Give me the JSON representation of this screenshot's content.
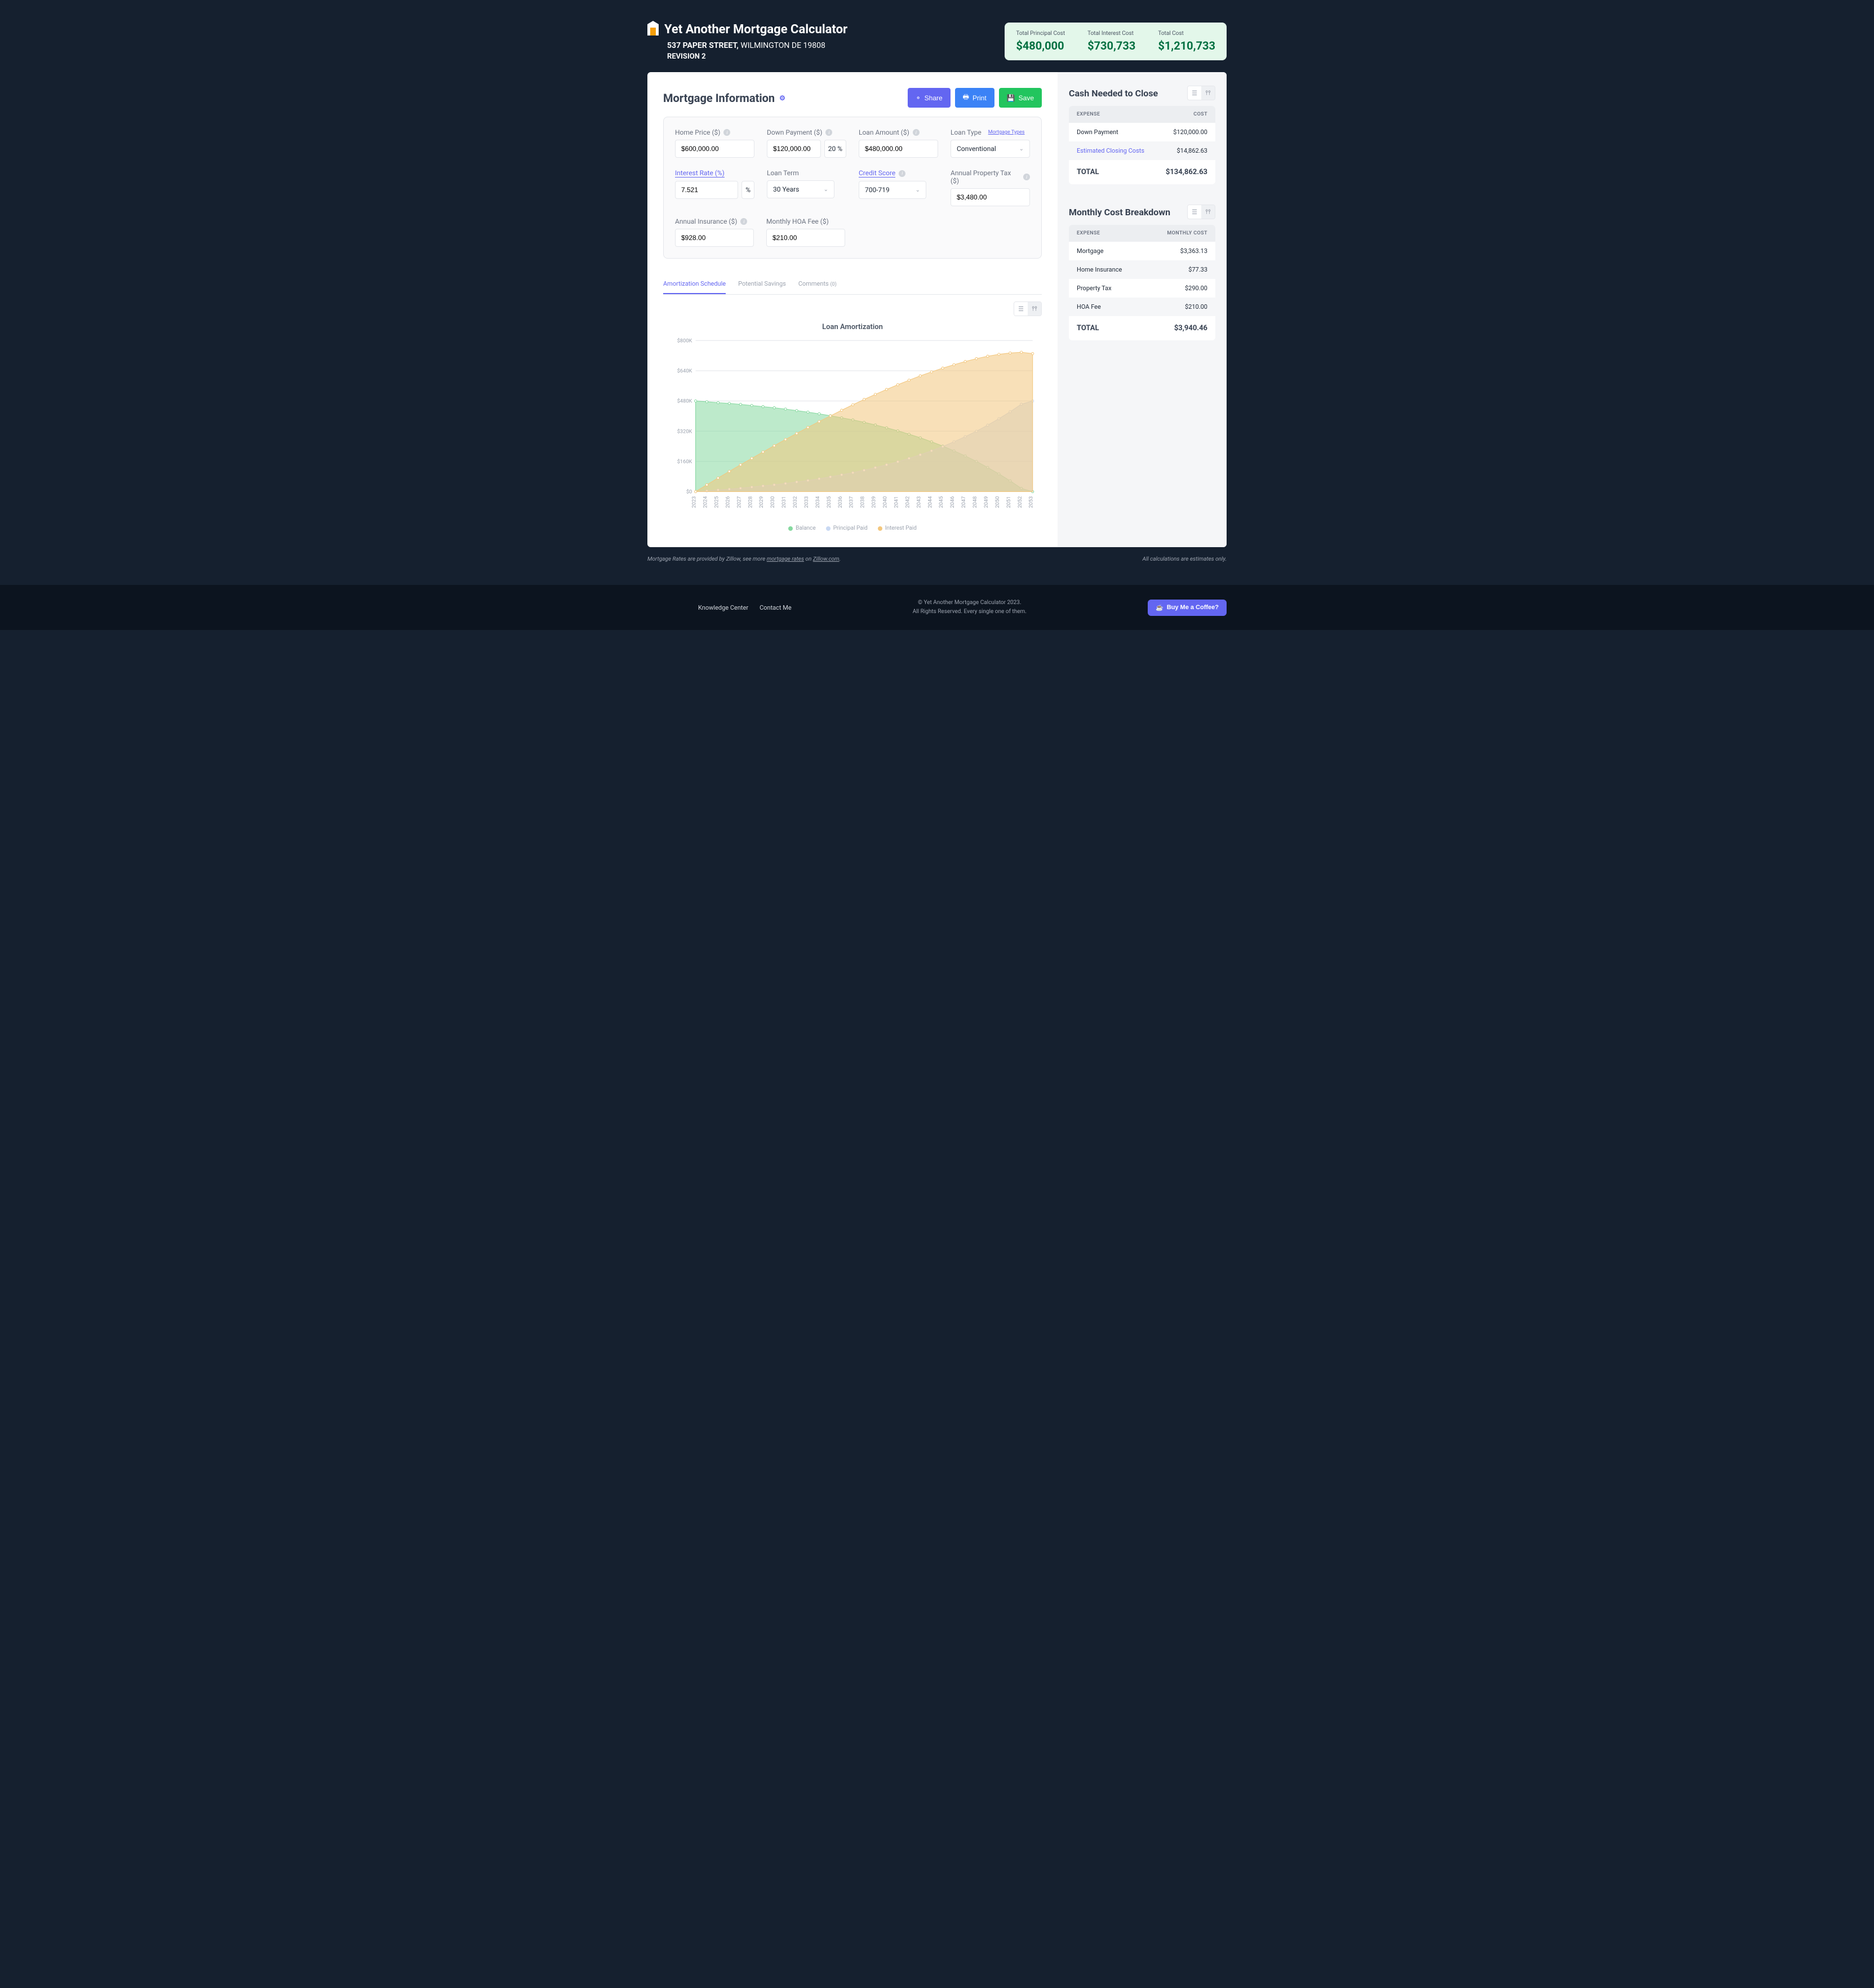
{
  "app_title": "Yet Another Mortgage Calculator",
  "address_street": "537 PAPER STREET,",
  "address_city": "WILMINGTON DE 19808",
  "revision": "REVISION 2",
  "summary": {
    "principal_label": "Total Principal Cost",
    "principal_value": "$480,000",
    "interest_label": "Total Interest Cost",
    "interest_value": "$730,733",
    "total_label": "Total Cost",
    "total_value": "$1,210,733"
  },
  "mortgage_info_title": "Mortgage Information",
  "buttons": {
    "share": "Share",
    "print": "Print",
    "save": "Save"
  },
  "form": {
    "home_price_label": "Home Price ($)",
    "home_price": "$600,000.00",
    "down_payment_label": "Down Payment ($)",
    "down_payment": "$120,000.00",
    "down_payment_pct": "20",
    "loan_amount_label": "Loan Amount ($)",
    "loan_amount": "$480,000.00",
    "loan_type_label": "Loan Type",
    "mortgage_types_link": "Mortgage Types",
    "loan_type": "Conventional",
    "interest_rate_label": "Interest Rate (%)",
    "interest_rate": "7.521",
    "loan_term_label": "Loan Term",
    "loan_term": "30 Years",
    "credit_score_label": "Credit Score",
    "credit_score": "700-719",
    "property_tax_label": "Annual Property Tax ($)",
    "property_tax": "$3,480.00",
    "insurance_label": "Annual Insurance ($)",
    "insurance": "$928.00",
    "hoa_label": "Monthly HOA Fee ($)",
    "hoa": "$210.00"
  },
  "tabs": {
    "amortization": "Amortization Schedule",
    "savings": "Potential Savings",
    "comments": "Comments",
    "comments_count": "(0)"
  },
  "chart_title": "Loan Amortization",
  "legend": {
    "balance": "Balance",
    "principal": "Principal Paid",
    "interest": "Interest Paid"
  },
  "cash_to_close": {
    "title": "Cash Needed to Close",
    "head_expense": "EXPENSE",
    "head_cost": "COST",
    "rows": [
      {
        "label": "Down Payment",
        "value": "$120,000.00"
      },
      {
        "label": "Estimated Closing Costs",
        "value": "$14,862.63",
        "link": true
      }
    ],
    "total_label": "TOTAL",
    "total_value": "$134,862.63"
  },
  "monthly": {
    "title": "Monthly Cost Breakdown",
    "head_expense": "EXPENSE",
    "head_cost": "MONTHLY COST",
    "rows": [
      {
        "label": "Mortgage",
        "value": "$3,363.13"
      },
      {
        "label": "Home Insurance",
        "value": "$77.33"
      },
      {
        "label": "Property Tax",
        "value": "$290.00"
      },
      {
        "label": "HOA Fee",
        "value": "$210.00"
      }
    ],
    "total_label": "TOTAL",
    "total_value": "$3,940.46"
  },
  "disclaimer_prefix": "Mortgage Rates are provided by Zillow, see more ",
  "disclaimer_link1": "mortgage rates",
  "disclaimer_on": " on ",
  "disclaimer_link2": "Zillow.com",
  "disclaimer_suffix": ".",
  "disclaimer_right": "All calculations are estimates only.",
  "footer": {
    "kc": "Knowledge Center",
    "contact": "Contact Me",
    "copyright_line1": "© Yet Another Mortgage Calculator 2023.",
    "copyright_line2": "All Rights Reserved. Every single one of them.",
    "coffee": "Buy Me a Coffee?"
  },
  "chart_data": {
    "type": "area",
    "title": "Loan Amortization",
    "xlabel": "",
    "ylabel": "",
    "ylim": [
      0,
      800000
    ],
    "y_ticks": [
      "$0",
      "$160K",
      "$320K",
      "$480K",
      "$640K",
      "$800K"
    ],
    "x": [
      2023,
      2024,
      2025,
      2026,
      2027,
      2028,
      2029,
      2030,
      2031,
      2032,
      2033,
      2034,
      2035,
      2036,
      2037,
      2038,
      2039,
      2040,
      2041,
      2042,
      2043,
      2044,
      2045,
      2046,
      2047,
      2048,
      2049,
      2050,
      2051,
      2052,
      2053
    ],
    "series": [
      {
        "name": "Balance",
        "color": "#86d9a0",
        "values": [
          480000,
          476000,
          471000,
          467000,
          462000,
          456000,
          450000,
          444000,
          437000,
          429000,
          421000,
          412000,
          402000,
          391000,
          380000,
          367000,
          353000,
          338000,
          322000,
          304000,
          285000,
          264000,
          241000,
          216000,
          189000,
          160000,
          128000,
          94000,
          57000,
          17000,
          0
        ]
      },
      {
        "name": "Principal Paid",
        "color": "#c9d9f3",
        "values": [
          0,
          4000,
          9000,
          13000,
          18000,
          24000,
          30000,
          36000,
          43000,
          51000,
          59000,
          68000,
          78000,
          89000,
          100000,
          113000,
          127000,
          142000,
          158000,
          176000,
          195000,
          216000,
          239000,
          264000,
          291000,
          320000,
          352000,
          386000,
          423000,
          463000,
          480000
        ]
      },
      {
        "name": "Interest Paid",
        "color": "#f3c77e",
        "values": [
          0,
          36000,
          72000,
          107000,
          142000,
          176000,
          210000,
          243000,
          276000,
          308000,
          340000,
          371000,
          401000,
          431000,
          460000,
          488000,
          515000,
          541000,
          566000,
          590000,
          613000,
          634000,
          654000,
          672000,
          689000,
          704000,
          717000,
          727000,
          734000,
          738000,
          731000
        ]
      }
    ]
  }
}
